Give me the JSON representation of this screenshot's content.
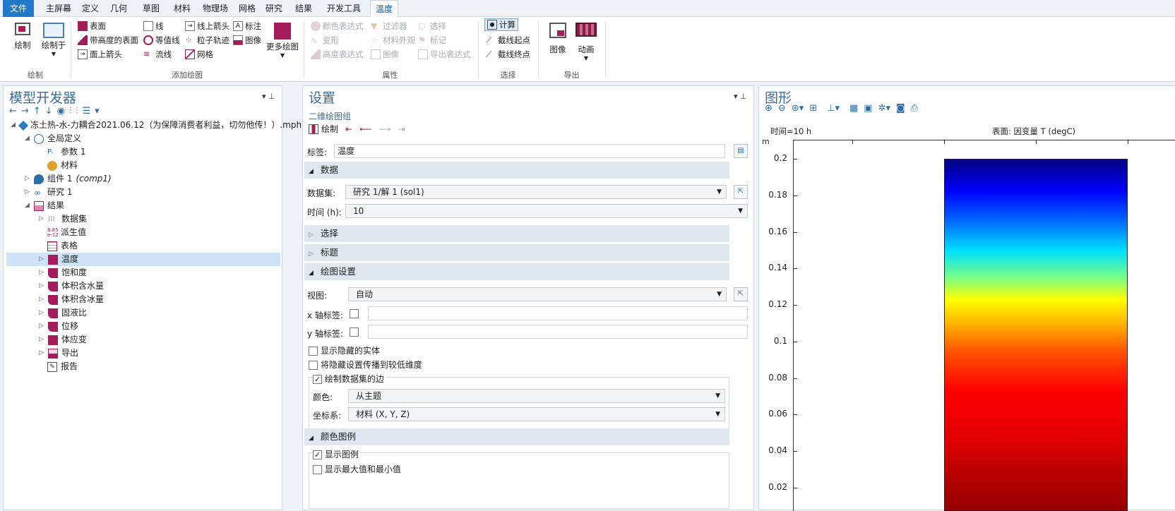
{
  "menu": {
    "tabs": [
      "文件",
      "主屏幕",
      "定义",
      "几何",
      "草图",
      "材料",
      "物理场",
      "网格",
      "研究",
      "结果",
      "开发工具",
      "温度"
    ]
  },
  "ribbon": {
    "draw": {
      "plot": "绘制",
      "plot_in": "绘制于",
      "group": "绘制"
    },
    "add": {
      "surface": "表面",
      "height_surface": "带高度的表面",
      "surface_arrow": "面上箭头",
      "line": "线",
      "contour": "等值线",
      "streamline": "流线",
      "line_arrow": "线上箭头",
      "particle": "粒子轨迹",
      "mesh": "网格",
      "annotation": "标注",
      "image": "图像",
      "more": "更多绘图",
      "group": "添加绘图"
    },
    "attr": {
      "color_expr": "颜色表达式",
      "deform": "变形",
      "height_expr": "高度表达式",
      "filter": "过滤器",
      "material_appearance": "材料外观",
      "image": "图像",
      "select": "选择",
      "marker": "标记",
      "export_expr": "导出表达式",
      "group": "属性"
    },
    "sel": {
      "compute": "计算",
      "line_start": "截线起点",
      "line_end": "截线终点",
      "group": "选择"
    },
    "export": {
      "image": "图像",
      "animation": "动画",
      "group": "导出"
    }
  },
  "model": {
    "title": "模型开发器",
    "items": [
      {
        "label": "冻土热-水-力耦合2021.06.12（为保障消费者利益，切勿他传！）.mph",
        "icon": "model-icon"
      },
      {
        "label": "全局定义",
        "icon": "globe-icon"
      },
      {
        "label": "参数 1",
        "icon": "parameter-icon"
      },
      {
        "label": "材料",
        "icon": "material-icon"
      },
      {
        "label": "组件 1",
        "tag": "(comp1)",
        "icon": "component-icon"
      },
      {
        "label": "研究 1",
        "icon": "study-icon"
      },
      {
        "label": "结果",
        "icon": "results-icon"
      },
      {
        "label": "数据集",
        "icon": "dataset-icon"
      },
      {
        "label": "派生值",
        "icon": "derived-values-icon"
      },
      {
        "label": "表格",
        "icon": "table-icon"
      },
      {
        "label": "温度",
        "icon": "plot-group-icon"
      },
      {
        "label": "饱和度",
        "icon": "plot-group-icon"
      },
      {
        "label": "体积含水量",
        "icon": "plot-group-icon"
      },
      {
        "label": "体积含冰量",
        "icon": "plot-group-icon"
      },
      {
        "label": "固液比",
        "icon": "plot-group-icon"
      },
      {
        "label": "位移",
        "icon": "plot-group-icon"
      },
      {
        "label": "体应变",
        "icon": "plot-group-icon"
      },
      {
        "label": "导出",
        "icon": "export-icon"
      },
      {
        "label": "报告",
        "icon": "report-icon"
      }
    ]
  },
  "settings": {
    "title": "设置",
    "subtitle": "二维绘图组",
    "plot": "绘制",
    "label_field": "标签:",
    "label_value": "温度",
    "sections": {
      "data": "数据",
      "selection": "选择",
      "title": "标题",
      "plot_settings": "绘图设置",
      "color_legend": "颜色图例"
    },
    "dataset_label": "数据集:",
    "dataset_value": "研究 1/解 1 (sol1)",
    "time_label": "时间 (h):",
    "time_value": "10",
    "view_label": "视图:",
    "view_value": "自动",
    "xaxis_label": "x 轴标签:",
    "yaxis_label": "y 轴标签:",
    "show_hidden": "显示隐藏的实体",
    "propagate_hidden": "将隐藏设置传播到较低维度",
    "plot_edges": "绘制数据集的边",
    "color_label": "颜色:",
    "color_value": "从主题",
    "coord_label": "坐标系:",
    "coord_value": "材料  (X, Y, Z)",
    "show_legend": "显示图例",
    "show_maxmin": "显示最大值和最小值"
  },
  "graphics": {
    "title": "图形",
    "time_text": "时间=10 h",
    "surface_text": "表面: 因变量 T (degC)",
    "unit": "m",
    "yticks": [
      "0.2",
      "0.18",
      "0.16",
      "0.14",
      "0.12",
      "0.1",
      "0.08",
      "0.06",
      "0.04",
      "0.02"
    ]
  }
}
